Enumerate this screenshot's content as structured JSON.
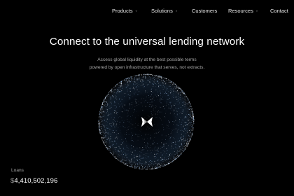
{
  "nav": {
    "items": [
      {
        "label": "Products",
        "has_menu": true
      },
      {
        "label": "Solutions",
        "has_menu": true
      },
      {
        "label": "Customers",
        "has_menu": false
      },
      {
        "label": "Resources",
        "has_menu": true
      },
      {
        "label": "Contact",
        "has_menu": false
      }
    ],
    "chevron": "⌄"
  },
  "hero": {
    "title": "Connect to the universal lending network",
    "subtitle_line1": "Access global liquidity at the best possible terms",
    "subtitle_line2": "powered by open infrastructure that serves, not extracts."
  },
  "globe": {
    "icon": "butterfly-logo-icon",
    "glow_color": "#9fc0e8"
  },
  "stats": {
    "label": "Loans",
    "currency": "$",
    "value": "4,410,502,196"
  },
  "colors": {
    "background": "#000000",
    "text": "#ffffff",
    "muted": "#a8a8a8"
  }
}
